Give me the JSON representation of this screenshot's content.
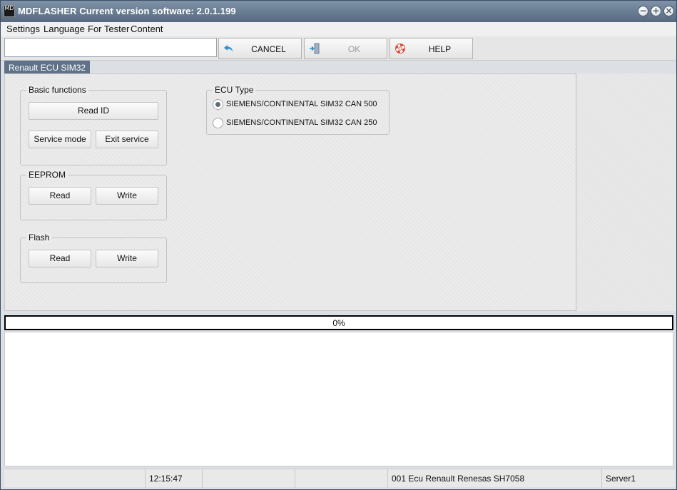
{
  "window": {
    "title": "MDFLASHER  Current version software: 2.0.1.199",
    "app_icon_text": "MD"
  },
  "menu": {
    "items": [
      "Settings",
      "Language",
      "For Tester",
      "Content"
    ]
  },
  "toolbar": {
    "input_value": "",
    "cancel_label": "CANCEL",
    "ok_label": "OK",
    "help_label": "HELP",
    "ok_disabled": true
  },
  "tabs": [
    {
      "label": "Renault ECU SIM32",
      "active": true
    }
  ],
  "basic_functions": {
    "title": "Basic functions",
    "read_id_label": "Read ID",
    "service_mode_label": "Service mode",
    "exit_service_label": "Exit service"
  },
  "eeprom": {
    "title": "EEPROM",
    "read_label": "Read",
    "write_label": "Write"
  },
  "flash": {
    "title": "Flash",
    "read_label": "Read",
    "write_label": "Write"
  },
  "ecu_type": {
    "title": "ECU Type",
    "options": [
      {
        "label": "SIEMENS/CONTINENTAL SIM32 CAN 500",
        "selected": true
      },
      {
        "label": "SIEMENS/CONTINENTAL SIM32 CAN 250",
        "selected": false
      }
    ]
  },
  "progress": {
    "text": "0%",
    "value": 0
  },
  "log": {
    "lines": []
  },
  "status": {
    "cells": [
      "",
      "12:15:47",
      "",
      "",
      "001 Ecu Renault Renesas SH7058",
      "Server1"
    ]
  },
  "colors": {
    "title_bar": "#56697e",
    "tab_active": "#5f7288",
    "help_icon": "#d94a38",
    "arrow_icon": "#2b8fd6"
  }
}
